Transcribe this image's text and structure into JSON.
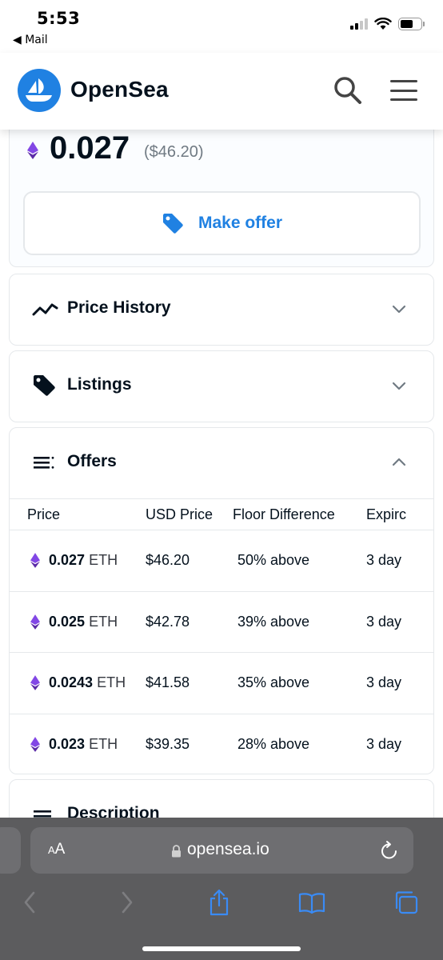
{
  "status_bar": {
    "time": "5:53",
    "back_label": "◀ Mail"
  },
  "header": {
    "brand": "OpenSea",
    "brand_color": "#2081e2",
    "icons": [
      "search-icon",
      "menu-icon"
    ]
  },
  "price": {
    "amount": "0.027",
    "usd": "($46.20)"
  },
  "make_offer": {
    "label": "Make offer",
    "icon": "tag-icon",
    "color": "#2081e2"
  },
  "sections": {
    "price_history": {
      "title": "Price History",
      "icon": "trend-line-icon",
      "expanded": false
    },
    "listings": {
      "title": "Listings",
      "icon": "tag-icon",
      "expanded": false
    },
    "offers": {
      "title": "Offers",
      "icon": "list-icon",
      "expanded": true
    },
    "description": {
      "title": "Description",
      "icon": "list-icon"
    }
  },
  "offers_table": {
    "columns": [
      "Price",
      "USD Price",
      "Floor Difference",
      "Expirc"
    ],
    "rows": [
      {
        "amount": "0.027",
        "unit": "ETH",
        "usd": "$46.20",
        "floor": "50% above",
        "expiry": "3 day"
      },
      {
        "amount": "0.025",
        "unit": "ETH",
        "usd": "$42.78",
        "floor": "39% above",
        "expiry": "3 day"
      },
      {
        "amount": "0.0243",
        "unit": "ETH",
        "usd": "$41.58",
        "floor": "35% above",
        "expiry": "3 day"
      },
      {
        "amount": "0.023",
        "unit": "ETH",
        "usd": "$39.35",
        "floor": "28% above",
        "expiry": "3 day"
      }
    ]
  },
  "safari": {
    "text_size_label": "AA",
    "url": "opensea.io",
    "toolbar_icons": [
      "back-icon",
      "forward-icon",
      "share-icon",
      "bookmarks-icon",
      "tabs-icon"
    ]
  },
  "colors": {
    "eth_purple": "#7b3fe4",
    "text": "#04111d",
    "muted": "#707a83",
    "border": "#e5e8eb"
  }
}
